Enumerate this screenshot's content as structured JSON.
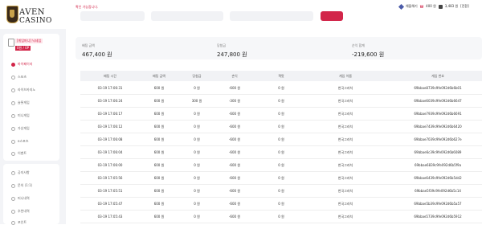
{
  "brand": {
    "line1": "AVEN",
    "line2": "CASINO"
  },
  "header": {
    "notice": "확인 가능합니다.",
    "user": {
      "rank_label": "해을해기",
      "points": "400 원",
      "cash": "3,483 원",
      "extra": "[전환]"
    }
  },
  "sidebar": {
    "user_name": "[게임머니] 닉네임",
    "user_money": "0원 / 0P",
    "items": [
      {
        "label": "마이페이지",
        "active": true
      },
      {
        "label": "스포츠"
      },
      {
        "label": "라이브카지노"
      },
      {
        "label": "슬롯게임"
      },
      {
        "label": "미니게임"
      },
      {
        "label": "가상게임"
      },
      {
        "label": "e스포츠"
      },
      {
        "label": "이벤트"
      }
    ],
    "items2": [
      {
        "label": "공지사항"
      },
      {
        "label": "문의 (1:1)"
      },
      {
        "label": "머니내역"
      },
      {
        "label": "추천내역"
      },
      {
        "label": "포인트"
      }
    ]
  },
  "summary": [
    {
      "label": "배팅 금액",
      "value": "467,400 원"
    },
    {
      "label": "당첨금",
      "value": "247,800 원"
    },
    {
      "label": "순익 합계",
      "value": "-219,600 원"
    }
  ],
  "table": {
    "columns": [
      "배팅 시간",
      "배팅 금액",
      "당첨금",
      "손익",
      "잭팟",
      "게임 이름",
      "게임 번호"
    ],
    "rows": [
      [
        "03-19 17:06:31",
        "600 원",
        "0 원",
        "-600 원",
        "0 원",
        "천국그라치",
        "69bbae8739c9fe092d6b6b01"
      ],
      [
        "03-19 17:06:24",
        "600 원",
        "300 원",
        "-300 원",
        "0 원",
        "천국그라치",
        "69bbae6039c9fe092d6b6647"
      ],
      [
        "03-19 17:06:17",
        "600 원",
        "0 원",
        "-600 원",
        "0 원",
        "천국그라치",
        "69bbae7939c9fe092d6b6691"
      ],
      [
        "03-19 17:06:12",
        "600 원",
        "0 원",
        "-600 원",
        "0 원",
        "천국그라치",
        "69bbae7439c9fe092d6b6420"
      ],
      [
        "03-19 17:06:08",
        "600 원",
        "0 원",
        "-600 원",
        "0 원",
        "천국그라치",
        "69bbae7039c9fe092d6b627e"
      ],
      [
        "03-19 17:06:04",
        "600 원",
        "0 원",
        "-600 원",
        "0 원",
        "천국그라치",
        "69bbae6c39c9fe092d6b6089"
      ],
      [
        "03-19 17:06:00",
        "600 원",
        "0 원",
        "-600 원",
        "0 원",
        "천국그라치",
        "69bbae6839c9fe092d6b5f9a"
      ],
      [
        "03-19 17:05:56",
        "600 원",
        "0 원",
        "-600 원",
        "0 원",
        "천국그라치",
        "69bbae6439c9fe092d6b5dd2"
      ],
      [
        "03-19 17:05:51",
        "600 원",
        "0 원",
        "-600 원",
        "0 원",
        "천국그라치",
        "69bbae5f39c9fe092d6b5c14"
      ],
      [
        "03-19 17:05:47",
        "600 원",
        "0 원",
        "-600 원",
        "0 원",
        "천국그라치",
        "69bbae5b39c9fe092d6b5a57"
      ],
      [
        "03-19 17:05:43",
        "600 원",
        "0 원",
        "-600 원",
        "0 원",
        "천국그라치",
        "69bbae5739c9fe092d6b5912"
      ]
    ]
  }
}
